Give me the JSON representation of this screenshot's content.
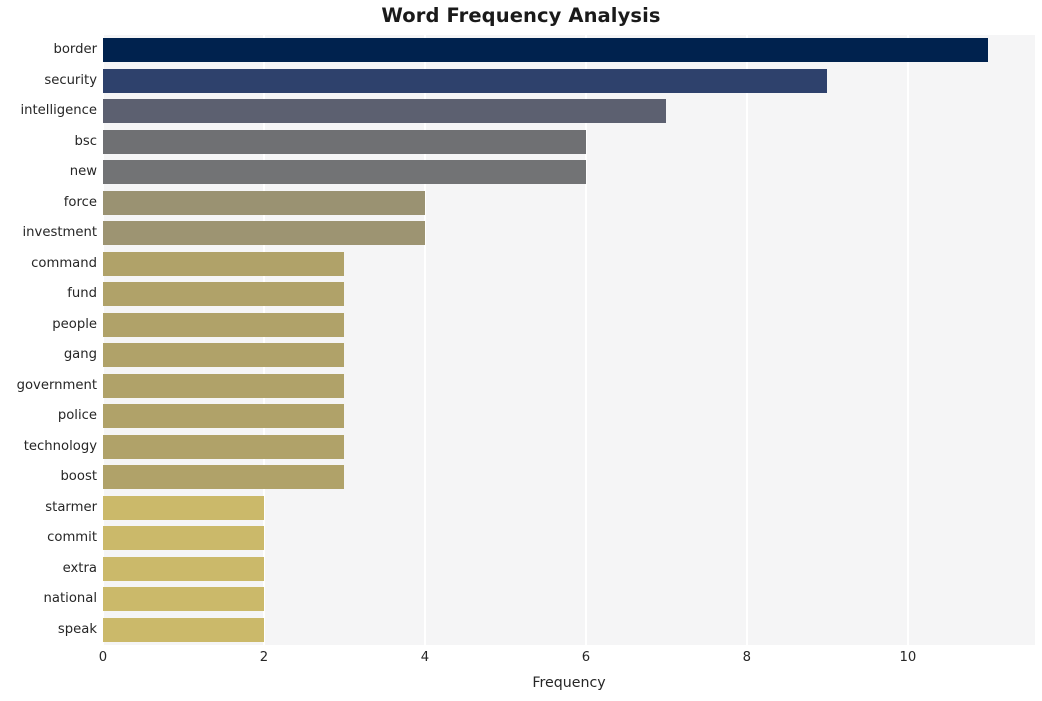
{
  "chart_data": {
    "type": "bar",
    "orientation": "horizontal",
    "title": "Word Frequency Analysis",
    "xlabel": "Frequency",
    "ylabel": "",
    "categories": [
      "border",
      "security",
      "intelligence",
      "bsc",
      "new",
      "force",
      "investment",
      "command",
      "fund",
      "people",
      "gang",
      "government",
      "police",
      "technology",
      "boost",
      "starmer",
      "commit",
      "extra",
      "national",
      "speak"
    ],
    "values": [
      11,
      9,
      7,
      6,
      6,
      4,
      4,
      3,
      3,
      3,
      3,
      3,
      3,
      3,
      3,
      2,
      2,
      2,
      2,
      2
    ],
    "bar_colors": [
      "#00224e",
      "#2e416c",
      "#5c6070",
      "#6f7073",
      "#727375",
      "#9a9272",
      "#9d9472",
      "#b0a269",
      "#b0a269",
      "#b0a269",
      "#b0a269",
      "#b0a269",
      "#b0a269",
      "#b0a269",
      "#b0a269",
      "#cbb96a",
      "#cbb96a",
      "#cbb96a",
      "#cbb96a",
      "#cbb96a"
    ],
    "xlim": [
      0,
      11.58
    ],
    "xticks": [
      0,
      2,
      4,
      6,
      8,
      10
    ],
    "xtick_labels": [
      "0",
      "2",
      "4",
      "6",
      "8",
      "10"
    ],
    "grid": "vertical",
    "legend": "none",
    "colormap": "cividis",
    "plot_background": "#f5f5f6",
    "grid_color": "#ffffff",
    "text_color": "#262626"
  }
}
